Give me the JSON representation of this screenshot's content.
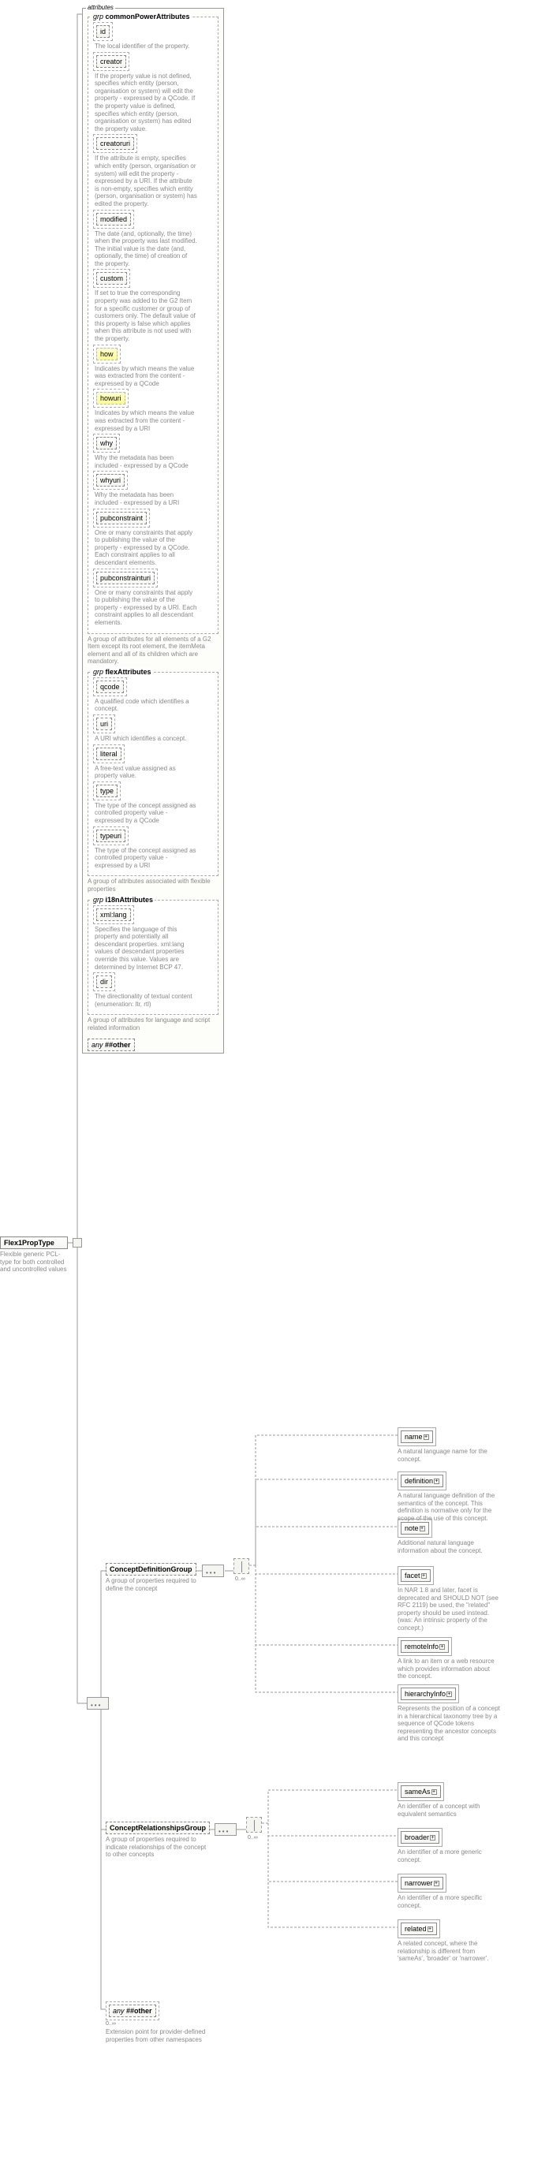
{
  "root": {
    "label": "Flex1PropType",
    "desc": "Flexible generic PCL-type for both controlled and uncontrolled values"
  },
  "attributes_keyword": "attributes",
  "grp_prefix": "grp",
  "any_prefix": "any",
  "any_other": "##other",
  "cardinality_unbounded": "0..∞",
  "groups": {
    "commonPower": {
      "title": "commonPowerAttributes",
      "desc": "A group of attributes for all elements of a G2 Item except its root element, the itemMeta element and all of its children which are mandatory.",
      "attrs": [
        {
          "name": "id",
          "desc": "The local identifier of the property."
        },
        {
          "name": "creator",
          "desc": "If the property value is not defined, specifies which entity (person, organisation or system) will edit the property - expressed by a QCode. If the property value is defined, specifies which entity (person, organisation or system) has edited the property value."
        },
        {
          "name": "creatoruri",
          "desc": "If the attribute is empty, specifies which entity (person, organisation or system) will edit the property - expressed by a URI. If the attribute is non-empty, specifies which entity (person, organisation or system) has edited the property."
        },
        {
          "name": "modified",
          "desc": "The date (and, optionally, the time) when the property was last modified. The initial value is the date (and, optionally, the time) of creation of the property."
        },
        {
          "name": "custom",
          "desc": "If set to true the corresponding property was added to the G2 Item for a specific customer or group of customers only. The default value of this property is false which applies when this attribute is not used with the property."
        },
        {
          "name": "how",
          "desc": "Indicates by which means the value was extracted from the content - expressed by a QCode",
          "hi": true
        },
        {
          "name": "howuri",
          "desc": "Indicates by which means the value was extracted from the content - expressed by a URI",
          "hi": true
        },
        {
          "name": "why",
          "desc": "Why the metadata has been included - expressed by a QCode"
        },
        {
          "name": "whyuri",
          "desc": "Why the metadata has been included - expressed by a URI"
        },
        {
          "name": "pubconstraint",
          "desc": "One or many constraints that apply to publishing the value of the property - expressed by a QCode. Each constraint applies to all descendant elements."
        },
        {
          "name": "pubconstrainturi",
          "desc": "One or many constraints that apply to publishing the value of the property - expressed by a URI. Each constraint applies to all descendant elements."
        }
      ]
    },
    "flex": {
      "title": "flexAttributes",
      "desc": "A group of attributes associated with flexible properties",
      "attrs": [
        {
          "name": "qcode",
          "desc": "A qualified code which identifies a concept."
        },
        {
          "name": "uri",
          "desc": "A URI which identifies a concept."
        },
        {
          "name": "literal",
          "desc": "A free-text value assigned as property value."
        },
        {
          "name": "type",
          "desc": "The type of the concept assigned as controlled property value - expressed by a QCode"
        },
        {
          "name": "typeuri",
          "desc": "The type of the concept assigned as controlled property value - expressed by a URI"
        }
      ]
    },
    "i18n": {
      "title": "i18nAttributes",
      "desc": "A group of attributes for language and script related information",
      "attrs": [
        {
          "name": "xml:lang",
          "desc": "Specifies the language of this property and potentially all descendant properties. xml:lang values of descendant properties override this value. Values are determined by Internet BCP 47."
        },
        {
          "name": "dir",
          "desc": "The directionality of textual content (enumeration: ltr, rtl)"
        }
      ]
    }
  },
  "conceptDef": {
    "label": "ConceptDefinitionGroup",
    "desc": "A group of properties required to define the concept",
    "children": [
      {
        "name": "name",
        "desc": "A natural language name for the concept.",
        "req": true
      },
      {
        "name": "definition",
        "desc": "A natural language definition of the semantics of the concept. This definition is normative only for the scope of the use of this concept."
      },
      {
        "name": "note",
        "desc": "Additional natural language information about the concept."
      },
      {
        "name": "facet",
        "desc": "In NAR 1.8 and later, facet is deprecated and SHOULD NOT (see RFC 2119) be used, the \"related\" property should be used instead.(was: An intrinsic property of the concept.)"
      },
      {
        "name": "remoteInfo",
        "desc": "A link to an item or a web resource which provides information about the concept."
      },
      {
        "name": "hierarchyInfo",
        "desc": "Represents the position of a concept in a hierarchical taxonomy tree by a sequence of QCode tokens representing the ancestor concepts and this concept"
      }
    ]
  },
  "conceptRel": {
    "label": "ConceptRelationshipsGroup",
    "desc": "A group of properties required to indicate relationships of the concept to other concepts",
    "children": [
      {
        "name": "sameAs",
        "desc": "An identifier of a concept with equivalent semantics"
      },
      {
        "name": "broader",
        "desc": "An identifier of a more generic concept."
      },
      {
        "name": "narrower",
        "desc": "An identifier of a more specific concept."
      },
      {
        "name": "related",
        "desc": "A related concept, where the relationship is different from 'sameAs', 'broader' or 'narrower'."
      }
    ]
  },
  "extension_desc": "Extension point for provider-defined properties from other namespaces"
}
